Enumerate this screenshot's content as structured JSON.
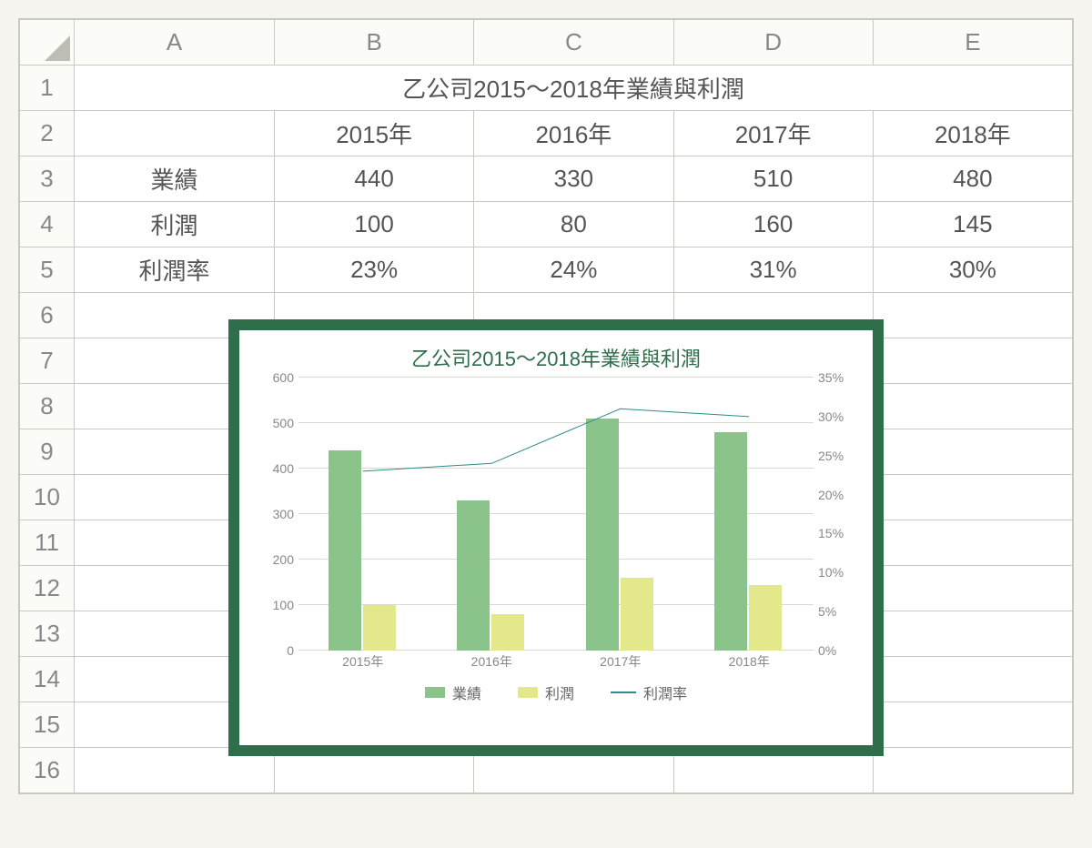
{
  "columns": [
    "A",
    "B",
    "C",
    "D",
    "E"
  ],
  "row_numbers": [
    1,
    2,
    3,
    4,
    5,
    6,
    7,
    8,
    9,
    10,
    11,
    12,
    13,
    14,
    15,
    16
  ],
  "title": "乙公司2015～2018年業績與利潤",
  "headers": {
    "b": "2015年",
    "c": "2016年",
    "d": "2017年",
    "e": "2018年"
  },
  "rows": {
    "perf_label": "業績",
    "perf": {
      "b": "440",
      "c": "330",
      "d": "510",
      "e": "480"
    },
    "profit_label": "利潤",
    "profit": {
      "b": "100",
      "c": "80",
      "d": "160",
      "e": "145"
    },
    "rate_label": "利潤率",
    "rate": {
      "b": "23%",
      "c": "24%",
      "d": "31%",
      "e": "30%"
    }
  },
  "chart_data": {
    "type": "bar+line",
    "title": "乙公司2015～2018年業績與利潤",
    "categories": [
      "2015年",
      "2016年",
      "2017年",
      "2018年"
    ],
    "series": [
      {
        "name": "業績",
        "kind": "bar",
        "axis": "left",
        "color": "#8bc48b",
        "values": [
          440,
          330,
          510,
          480
        ]
      },
      {
        "name": "利潤",
        "kind": "bar",
        "axis": "left",
        "color": "#e3e88a",
        "values": [
          100,
          80,
          160,
          145
        ]
      },
      {
        "name": "利潤率",
        "kind": "line",
        "axis": "right",
        "color": "#2a8c8c",
        "values": [
          23,
          24,
          31,
          30
        ]
      }
    ],
    "y_left": {
      "min": 0,
      "max": 600,
      "step": 100,
      "ticks": [
        0,
        100,
        200,
        300,
        400,
        500,
        600
      ]
    },
    "y_right": {
      "min": 0,
      "max": 35,
      "step": 5,
      "suffix": "%",
      "ticks": [
        0,
        5,
        10,
        15,
        20,
        25,
        30,
        35
      ]
    },
    "legend": {
      "perf": "業績",
      "profit": "利潤",
      "rate": "利潤率"
    }
  }
}
